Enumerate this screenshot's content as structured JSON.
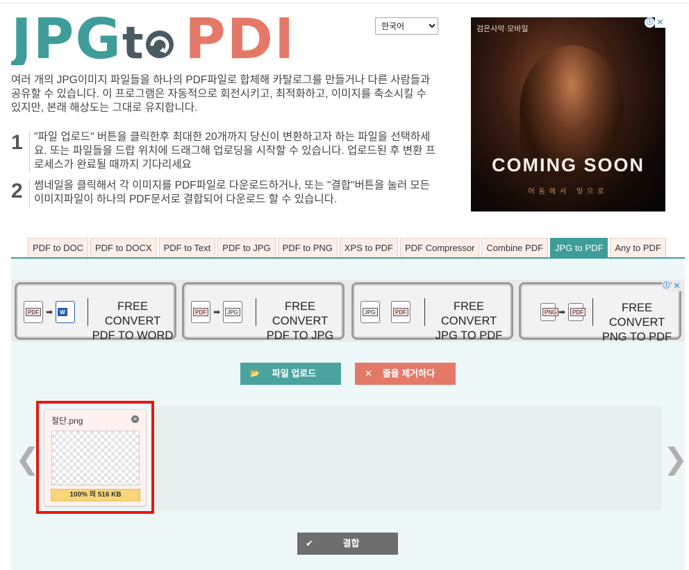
{
  "logo": {
    "part1": "JPG",
    "part2": "t",
    "part3": "PDF"
  },
  "language": {
    "selected": "한국어"
  },
  "intro": "여러 개의 JPG이미지 파일들을 하나의 PDF파일로 합체해 카탈로그를 만들거나 다른 사람들과 공유할 수 있습니다. 이 프로그램은 자동적으로 회전시키고, 최적화하고, 이미지를 축소시킬 수 있지만, 본래 해상도는 그대로 유지합니다.",
  "steps": [
    {
      "num": "1",
      "text": "\"파일 업로드\" 버튼을 클릭한후 최대한 20개까지 당신이 변환하고자 하는 파일을 선택하세요. 또는 파일들을 드랍 위치에 드래그해 업로딩을 시작할 수 있습니다. 업로드된 후 변환 프로세스가 완료될 때까지 기다리세요"
    },
    {
      "num": "2",
      "text": "썸네일을 클릭해서 각 이미지를 PDF파일로 다운로드하거나, 또는 \"결합\"버튼을 눌러 모든 이미지파일이 하나의 PDF문서로 결합되어 다운로드 할 수 있습니다."
    }
  ],
  "ad_top": {
    "small_title": "검은사막·모바일",
    "headline": "COMING SOON",
    "subline": "어둠에서 빛으로",
    "info_icon": "ⓘ",
    "close_icon": "✕"
  },
  "tabs": [
    {
      "label": "PDF to DOC",
      "active": false
    },
    {
      "label": "PDF to DOCX",
      "active": false
    },
    {
      "label": "PDF to Text",
      "active": false
    },
    {
      "label": "PDF to JPG",
      "active": false
    },
    {
      "label": "PDF to PNG",
      "active": false
    },
    {
      "label": "XPS to PDF",
      "active": false
    },
    {
      "label": "PDF Compressor",
      "active": false
    },
    {
      "label": "Combine PDF",
      "active": false
    },
    {
      "label": "JPG to PDF",
      "active": true
    },
    {
      "label": "Any to PDF",
      "active": false
    }
  ],
  "banner_ad": {
    "cards": [
      {
        "line1": "FREE CONVERT",
        "line2": "PDF TO WORD",
        "from": "PDF",
        "to": "W"
      },
      {
        "line1": "FREE CONVERT",
        "line2": "PDF TO JPG",
        "from": "PDF",
        "to": "JPG"
      },
      {
        "line1": "FREE CONVERT",
        "line2": "JPG TO PDF",
        "from": "JPG",
        "to": "PDF"
      },
      {
        "line1": "FREE CONVERT",
        "line2": "PNG TO PDF",
        "from": "PNG",
        "to": "PDF"
      }
    ],
    "info_icon": "ⓘ",
    "close_icon": "✕"
  },
  "buttons": {
    "upload": "파일 업로드",
    "remove": "줄을 제거하다",
    "combine": "결합"
  },
  "file": {
    "name": "절단.png",
    "progress_text": "100% 의 516 KB",
    "progress": 100
  },
  "nav": {
    "prev": "❮",
    "next": "❯"
  },
  "colors": {
    "teal": "#3e9d99",
    "coral": "#e57968",
    "gray": "#6e6e6e",
    "highlight": "#e8160e"
  }
}
